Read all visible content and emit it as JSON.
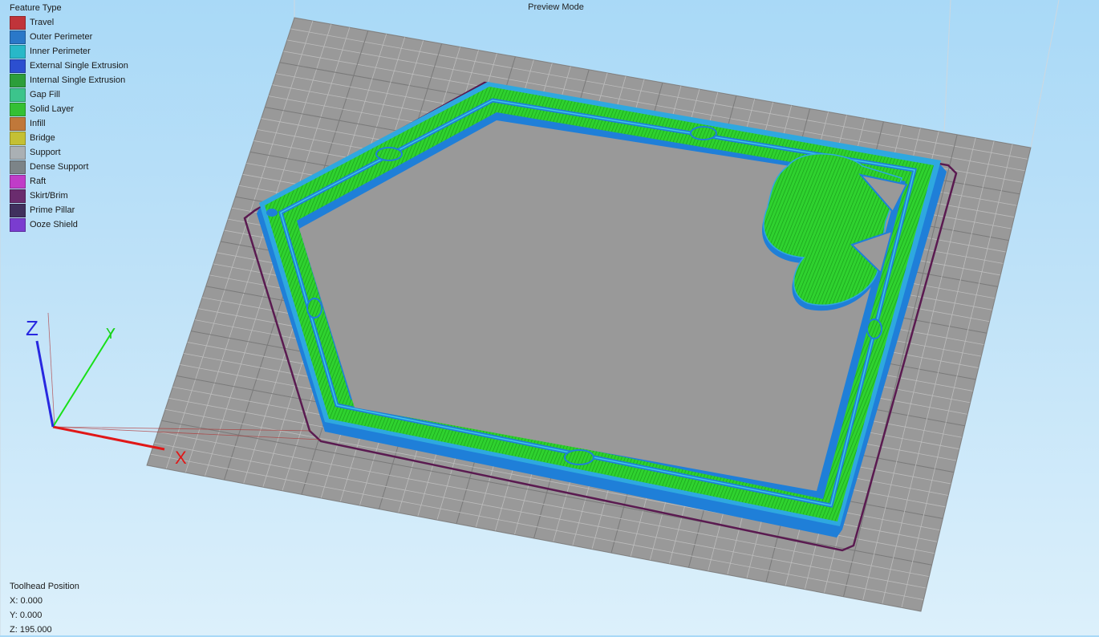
{
  "viewport": {
    "mode_label": "Preview Mode"
  },
  "legend": {
    "title": "Feature Type",
    "items": [
      {
        "label": "Travel",
        "color": "#c0343a"
      },
      {
        "label": "Outer Perimeter",
        "color": "#2a78c8"
      },
      {
        "label": "Inner Perimeter",
        "color": "#28b8c8"
      },
      {
        "label": "External Single Extrusion",
        "color": "#2c4fd0"
      },
      {
        "label": "Internal Single Extrusion",
        "color": "#2c9e3a"
      },
      {
        "label": "Gap Fill",
        "color": "#3cc48c"
      },
      {
        "label": "Solid Layer",
        "color": "#34c034"
      },
      {
        "label": "Infill",
        "color": "#c0783a"
      },
      {
        "label": "Bridge",
        "color": "#c4c034"
      },
      {
        "label": "Support",
        "color": "#aab0b4"
      },
      {
        "label": "Dense Support",
        "color": "#7c8488"
      },
      {
        "label": "Raft",
        "color": "#c03cc8"
      },
      {
        "label": "Skirt/Brim",
        "color": "#6a2c6e"
      },
      {
        "label": "Prime Pillar",
        "color": "#40305e"
      },
      {
        "label": "Ooze Shield",
        "color": "#7a3cd0"
      }
    ]
  },
  "axes": {
    "x": "X",
    "y": "Y",
    "z": "Z"
  },
  "toolhead": {
    "title": "Toolhead Position",
    "x": "X: 0.000",
    "y": "Y: 0.000",
    "z": "Z: 195.000"
  }
}
